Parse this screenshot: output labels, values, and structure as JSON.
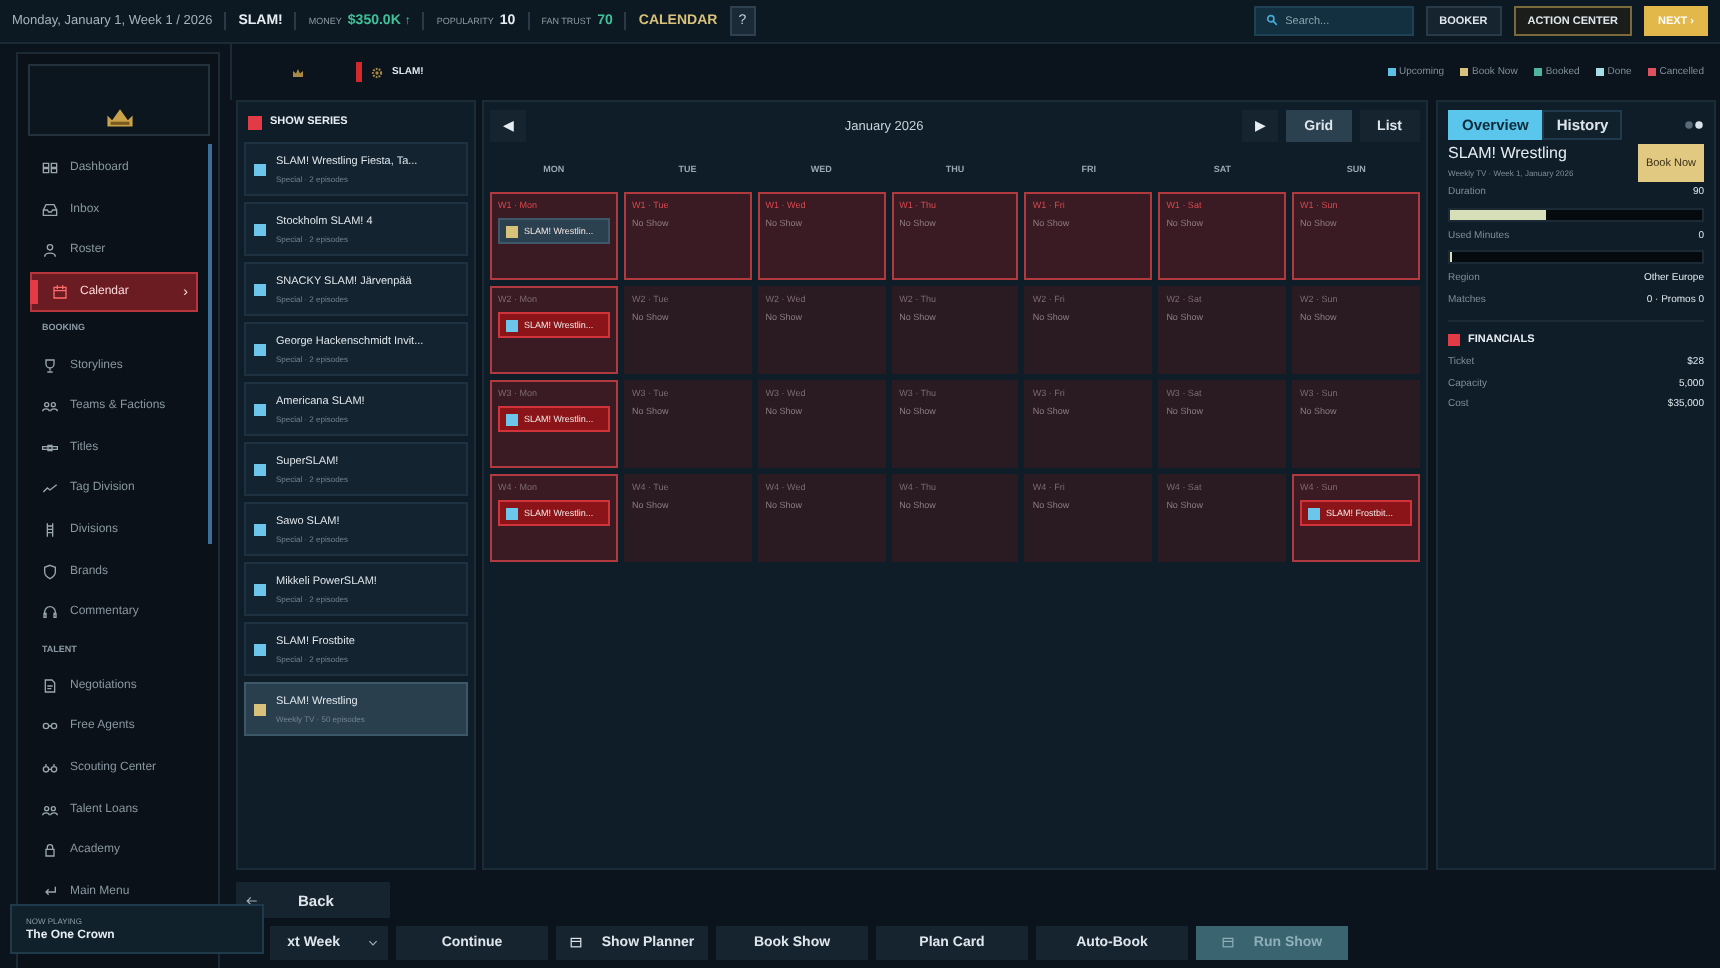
{
  "top_bar": {
    "date": "Monday, January 1, Week 1 / 2026",
    "company": "SLAM!",
    "stats": [
      {
        "label": "MONEY",
        "value": "$350.0K",
        "trend": "↑",
        "color": "#3fc29a"
      },
      {
        "label": "POPULARITY",
        "value": "10",
        "color": "#e6edf2"
      },
      {
        "label": "FAN TRUST",
        "value": "70",
        "color": "#3fc29a"
      }
    ],
    "section": "CALENDAR",
    "help": "?",
    "search": {
      "placeholder": "Search..."
    },
    "buttons": [
      {
        "label": "BOOKER",
        "kind": "plain"
      },
      {
        "label": "ACTION CENTER",
        "kind": "outlined"
      },
      {
        "label": "NEXT ›",
        "kind": "primary"
      }
    ]
  },
  "sidebar": {
    "sections": [
      {
        "items": [
          {
            "label": "Dashboard",
            "selected": false
          },
          {
            "label": "Inbox",
            "selected": false
          },
          {
            "label": "Roster",
            "selected": false
          },
          {
            "label": "Calendar",
            "selected": true,
            "arrow": "›"
          }
        ]
      },
      {
        "heading": "BOOKING",
        "items": [
          {
            "label": "Storylines",
            "selected": false
          },
          {
            "label": "Teams & Factions",
            "selected": false
          },
          {
            "label": "Titles",
            "selected": false
          },
          {
            "label": "Tag Division",
            "selected": false
          },
          {
            "label": "Divisions",
            "selected": false
          },
          {
            "label": "Brands",
            "selected": false
          },
          {
            "label": "Commentary",
            "selected": false
          }
        ]
      },
      {
        "heading": "TALENT",
        "items": [
          {
            "label": "Negotiations",
            "selected": false
          },
          {
            "label": "Free Agents",
            "selected": false
          },
          {
            "label": "Scouting Center",
            "selected": false
          },
          {
            "label": "Talent Loans",
            "selected": false
          },
          {
            "label": "Academy",
            "selected": false
          },
          {
            "label": "Main Menu",
            "selected": false
          }
        ]
      }
    ]
  },
  "now_playing": {
    "label": "NOW PLAYING",
    "title": "The One Crown"
  },
  "strip": {
    "brand": "SLAM!"
  },
  "legend": [
    {
      "label": "Upcoming",
      "color": "#5bbfe8"
    },
    {
      "label": "Book Now",
      "color": "#d8c17a"
    },
    {
      "label": "Booked",
      "color": "#4fb39e"
    },
    {
      "label": "Done",
      "color": "#a9dce9"
    },
    {
      "label": "Cancelled",
      "color": "#e0505e"
    }
  ],
  "series": {
    "heading": "SHOW SERIES",
    "items": [
      {
        "title": "SLAM! Wrestling Fiesta, Ta...",
        "meta": "Special · 2 episodes",
        "color": "#6cc6ec",
        "selected": false
      },
      {
        "title": "Stockholm SLAM! 4",
        "meta": "Special · 2 episodes",
        "color": "#6cc6ec",
        "selected": false
      },
      {
        "title": "SNACKY SLAM! Järvenpää",
        "meta": "Special · 2 episodes",
        "color": "#6cc6ec",
        "selected": false
      },
      {
        "title": "George Hackenschmidt Invit...",
        "meta": "Special · 2 episodes",
        "color": "#6cc6ec",
        "selected": false
      },
      {
        "title": "Americana SLAM!",
        "meta": "Special · 2 episodes",
        "color": "#6cc6ec",
        "selected": false
      },
      {
        "title": "SuperSLAM!",
        "meta": "Special · 2 episodes",
        "color": "#6cc6ec",
        "selected": false
      },
      {
        "title": "Sawo SLAM!",
        "meta": "Special · 2 episodes",
        "color": "#6cc6ec",
        "selected": false
      },
      {
        "title": "Mikkeli PowerSLAM!",
        "meta": "Special · 2 episodes",
        "color": "#6cc6ec",
        "selected": false
      },
      {
        "title": "SLAM! Frostbite",
        "meta": "Special · 2 episodes",
        "color": "#6cc6ec",
        "selected": false
      },
      {
        "title": "SLAM! Wrestling",
        "meta": "Weekly TV · 50 episodes",
        "color": "#d8c17a",
        "selected": true
      }
    ]
  },
  "calendar": {
    "prev": "◀",
    "month": "January 2026",
    "next": "▶",
    "views": [
      {
        "label": "Grid",
        "selected": true
      },
      {
        "label": "List",
        "selected": false
      }
    ],
    "days": [
      "MON",
      "TUE",
      "WED",
      "THU",
      "FRI",
      "SAT",
      "SUN"
    ],
    "weeks": [
      {
        "current": true,
        "cells": [
          {
            "label": "W1 · Mon",
            "highlighted": true,
            "event": {
              "title": "SLAM! Wrestlin...",
              "color": "#d8c17a",
              "selected": true
            }
          },
          {
            "label": "W1 · Tue",
            "highlighted": true,
            "note": "No Show"
          },
          {
            "label": "W1 · Wed",
            "highlighted": true,
            "note": "No Show"
          },
          {
            "label": "W1 · Thu",
            "highlighted": true,
            "note": "No Show"
          },
          {
            "label": "W1 · Fri",
            "highlighted": true,
            "note": "No Show"
          },
          {
            "label": "W1 · Sat",
            "highlighted": true,
            "note": "No Show"
          },
          {
            "label": "W1 · Sun",
            "highlighted": true,
            "note": "No Show"
          }
        ]
      },
      {
        "current": false,
        "cells": [
          {
            "label": "W2 · Mon",
            "highlighted": true,
            "event": {
              "title": "SLAM! Wrestlin...",
              "color": "#6cc6ec",
              "selected": false
            }
          },
          {
            "label": "W2 · Tue",
            "highlighted": false,
            "note": "No Show"
          },
          {
            "label": "W2 · Wed",
            "highlighted": false,
            "note": "No Show"
          },
          {
            "label": "W2 · Thu",
            "highlighted": false,
            "note": "No Show"
          },
          {
            "label": "W2 · Fri",
            "highlighted": false,
            "note": "No Show"
          },
          {
            "label": "W2 · Sat",
            "highlighted": false,
            "note": "No Show"
          },
          {
            "label": "W2 · Sun",
            "highlighted": false,
            "note": "No Show"
          }
        ]
      },
      {
        "current": false,
        "cells": [
          {
            "label": "W3 · Mon",
            "highlighted": true,
            "event": {
              "title": "SLAM! Wrestlin...",
              "color": "#6cc6ec",
              "selected": false
            }
          },
          {
            "label": "W3 · Tue",
            "highlighted": false,
            "note": "No Show"
          },
          {
            "label": "W3 · Wed",
            "highlighted": false,
            "note": "No Show"
          },
          {
            "label": "W3 · Thu",
            "highlighted": false,
            "note": "No Show"
          },
          {
            "label": "W3 · Fri",
            "highlighted": false,
            "note": "No Show"
          },
          {
            "label": "W3 · Sat",
            "highlighted": false,
            "note": "No Show"
          },
          {
            "label": "W3 · Sun",
            "highlighted": false,
            "note": "No Show"
          }
        ]
      },
      {
        "current": false,
        "cells": [
          {
            "label": "W4 · Mon",
            "highlighted": true,
            "event": {
              "title": "SLAM! Wrestlin...",
              "color": "#6cc6ec",
              "selected": false
            }
          },
          {
            "label": "W4 · Tue",
            "highlighted": false,
            "note": "No Show"
          },
          {
            "label": "W4 · Wed",
            "highlighted": false,
            "note": "No Show"
          },
          {
            "label": "W4 · Thu",
            "highlighted": false,
            "note": "No Show"
          },
          {
            "label": "W4 · Fri",
            "highlighted": false,
            "note": "No Show"
          },
          {
            "label": "W4 · Sat",
            "highlighted": false,
            "note": "No Show"
          },
          {
            "label": "W4 · Sun",
            "highlighted": true,
            "event": {
              "title": "SLAM! Frostbit...",
              "color": "#6cc6ec",
              "selected": false
            }
          }
        ]
      }
    ]
  },
  "details": {
    "tabs": [
      {
        "label": "Overview",
        "selected": true
      },
      {
        "label": "History",
        "selected": false
      }
    ],
    "title": "SLAM! Wrestling",
    "subtitle": "Weekly TV · Week 1, January 2026",
    "action": "Book Now",
    "metrics": [
      {
        "label": "Duration",
        "value": "90",
        "level": 0.38
      },
      {
        "label": "Used Minutes",
        "value": "0",
        "level": 0
      }
    ],
    "rows": [
      {
        "label": "Region",
        "value": "Other Europe"
      },
      {
        "label": "Matches",
        "value": "0 · Promos 0"
      }
    ],
    "financials": {
      "heading": "FINANCIALS",
      "rows": [
        {
          "label": "Ticket",
          "value": "$28"
        },
        {
          "label": "Capacity",
          "value": "5,000"
        },
        {
          "label": "Cost",
          "value": "$35,000"
        }
      ]
    }
  },
  "back": "Back",
  "actions": [
    {
      "label": "xt Week",
      "kind": "dropdown",
      "disabled": false
    },
    {
      "label": "Continue",
      "kind": "plain",
      "disabled": false
    },
    {
      "label": "Show Planner",
      "kind": "icon",
      "disabled": false
    },
    {
      "label": "Book Show",
      "kind": "plain",
      "disabled": false
    },
    {
      "label": "Plan Card",
      "kind": "plain",
      "disabled": false
    },
    {
      "label": "Auto-Book",
      "kind": "plain",
      "disabled": false
    },
    {
      "label": "Run Show",
      "kind": "icon",
      "disabled": true
    }
  ]
}
